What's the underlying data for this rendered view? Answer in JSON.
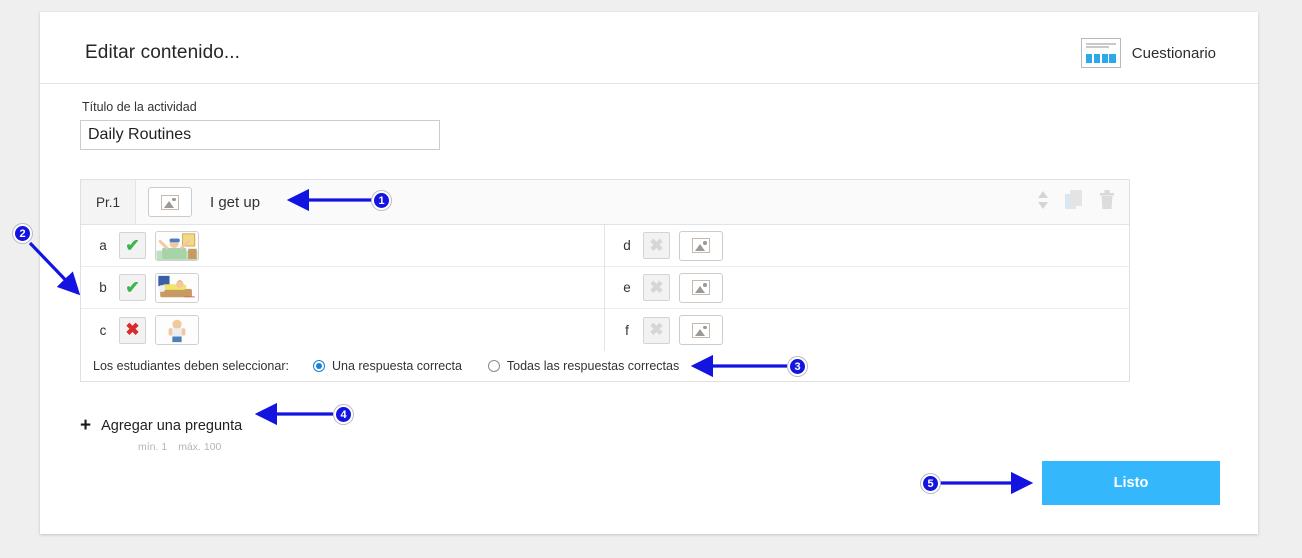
{
  "header": {
    "title": "Editar contenido...",
    "type_label": "Cuestionario",
    "type_icon": "quiz-icon"
  },
  "activity": {
    "title_label": "Título de la actividad",
    "title_value": "Daily Routines",
    "title_placeholder": "Título de la actividad"
  },
  "question": {
    "number_label": "Pr.1",
    "image_button_icon": "image-placeholder-icon",
    "text": "I get up",
    "tools": {
      "reorder": "sort-arrows-icon",
      "duplicate": "copy-icon",
      "delete": "trash-icon"
    },
    "answers_left": [
      {
        "letter": "a",
        "mark": "check",
        "has_image": true,
        "image_alt": "waking-up-in-bed"
      },
      {
        "letter": "b",
        "mark": "check",
        "has_image": true,
        "image_alt": "sleeping-in-bed"
      },
      {
        "letter": "c",
        "mark": "cross",
        "has_image": true,
        "image_alt": "getting-dressed"
      }
    ],
    "answers_right": [
      {
        "letter": "d",
        "mark": "cross-disabled",
        "has_image": false,
        "image_alt": ""
      },
      {
        "letter": "e",
        "mark": "cross-disabled",
        "has_image": false,
        "image_alt": ""
      },
      {
        "letter": "f",
        "mark": "cross-disabled",
        "has_image": false,
        "image_alt": ""
      }
    ],
    "selection": {
      "label": "Los estudiantes deben seleccionar:",
      "options": [
        {
          "label": "Una respuesta correcta",
          "selected": true
        },
        {
          "label": "Todas las respuestas correctas",
          "selected": false
        }
      ]
    }
  },
  "add_question": {
    "plus": "+",
    "label": "Agregar una pregunta",
    "min": "mín. 1",
    "max": "máx. 100"
  },
  "footer": {
    "done_label": "Listo"
  },
  "annotations": [
    {
      "number": "1"
    },
    {
      "number": "2"
    },
    {
      "number": "3"
    },
    {
      "number": "4"
    },
    {
      "number": "5"
    }
  ],
  "colors": {
    "accent_blue": "#35b7fb",
    "annotation_blue": "#1414e0",
    "check_green": "#3cb54a",
    "cross_red": "#d92b2b",
    "page_bg": "#efefef"
  }
}
